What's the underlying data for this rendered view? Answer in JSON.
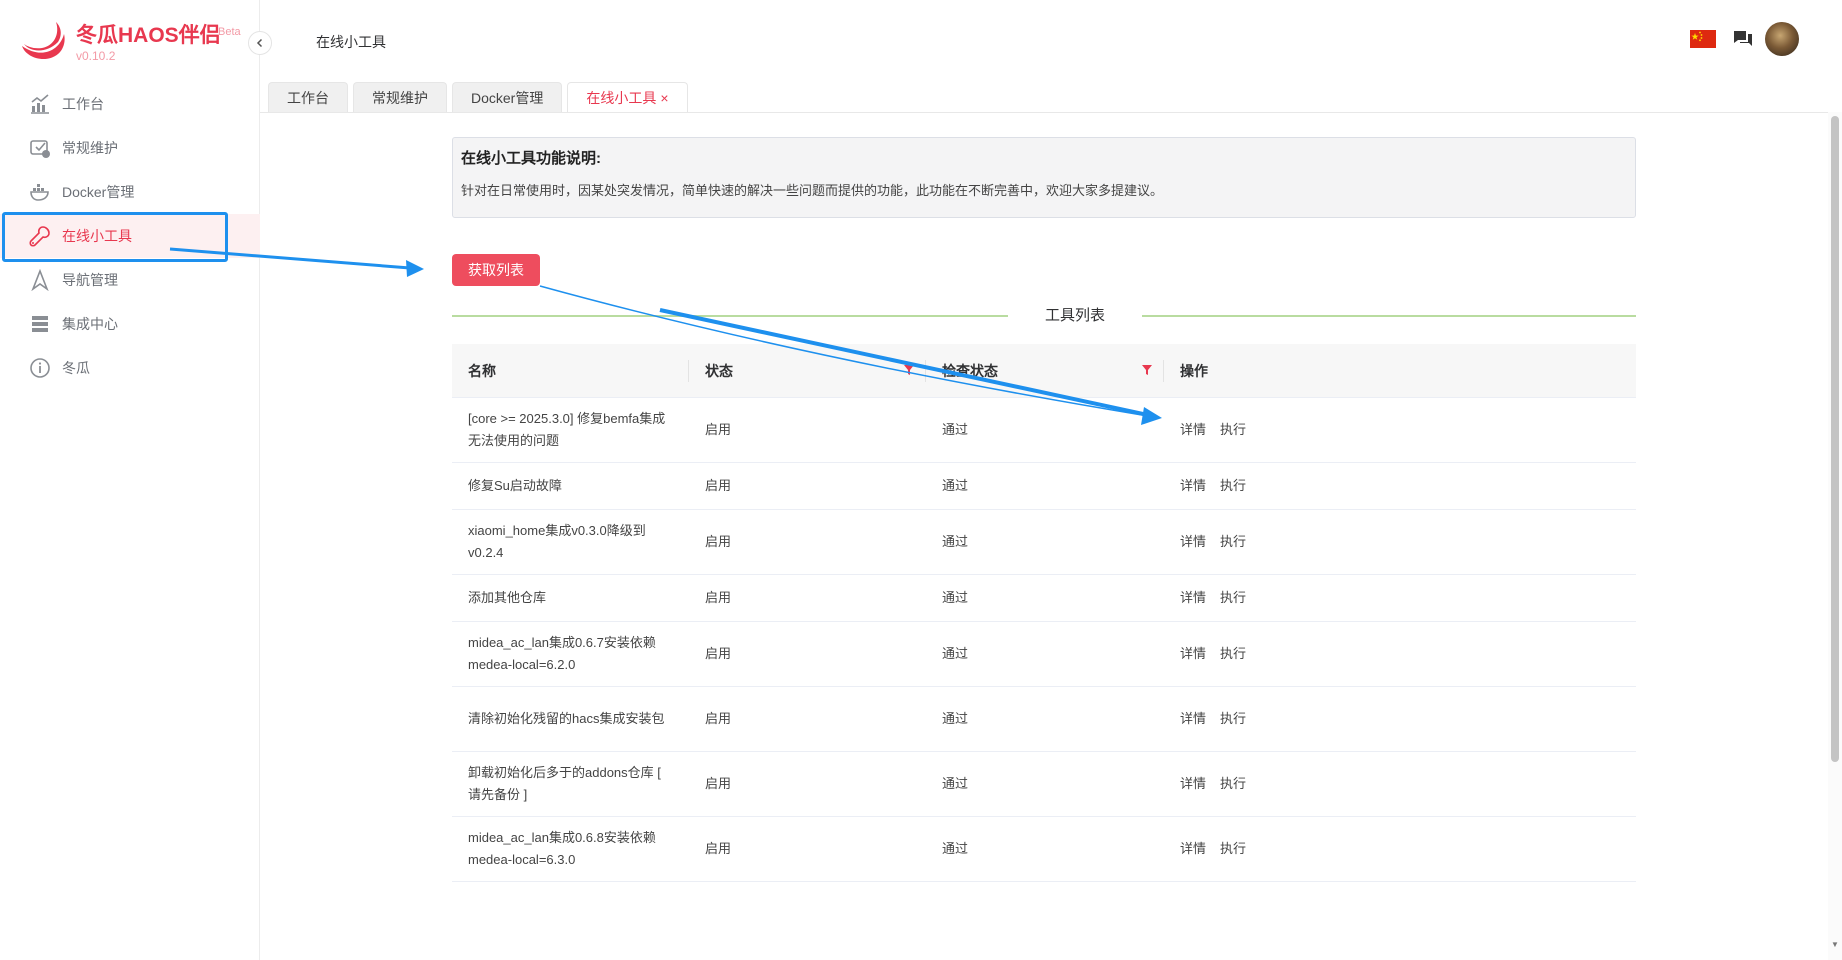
{
  "brand": {
    "name": "冬瓜HAOS伴侣",
    "beta": "Beta",
    "version": "v0.10.2",
    "color": "#e8384f"
  },
  "sidebar": {
    "items": [
      {
        "label": "工作台",
        "icon": "dashboard-chart-icon",
        "active": false
      },
      {
        "label": "常规维护",
        "icon": "maintenance-icon",
        "active": false
      },
      {
        "label": "Docker管理",
        "icon": "docker-icon",
        "active": false
      },
      {
        "label": "在线小工具",
        "icon": "wrench-icon",
        "active": true
      },
      {
        "label": "导航管理",
        "icon": "navigation-icon",
        "active": false
      },
      {
        "label": "集成中心",
        "icon": "server-icon",
        "active": false
      },
      {
        "label": "冬瓜",
        "icon": "info-icon",
        "active": false
      }
    ]
  },
  "header": {
    "title": "在线小工具",
    "icons": [
      "china-flag-icon",
      "chat-icon",
      "avatar"
    ]
  },
  "tabs": [
    {
      "label": "工作台",
      "active": false
    },
    {
      "label": "常规维护",
      "active": false
    },
    {
      "label": "Docker管理",
      "active": false
    },
    {
      "label": "在线小工具",
      "active": true,
      "close": "×"
    }
  ],
  "notice": {
    "title": "在线小工具功能说明:",
    "text": "针对在日常使用时，因某处突发情况，简单快速的解决一些问题而提供的功能，此功能在不断完善中，欢迎大家多提建议。"
  },
  "fetch_button": "获取列表",
  "divider_label": "工具列表",
  "table": {
    "headers": [
      "名称",
      "状态",
      "检查状态",
      "操作"
    ],
    "action_labels": [
      "详情",
      "执行"
    ],
    "rows": [
      {
        "name": "[core >= 2025.3.0] 修复bemfa集成无法使用的问题",
        "status": "启用",
        "check": "通过",
        "height": 65
      },
      {
        "name": "修复Su启动故障",
        "status": "启用",
        "check": "通过",
        "height": 47
      },
      {
        "name": "xiaomi_home集成v0.3.0降级到v0.2.4",
        "status": "启用",
        "check": "通过",
        "height": 65
      },
      {
        "name": "添加其他仓库",
        "status": "启用",
        "check": "通过",
        "height": 47
      },
      {
        "name": "midea_ac_lan集成0.6.7安装依赖medea-local=6.2.0",
        "status": "启用",
        "check": "通过",
        "height": 65
      },
      {
        "name": "清除初始化残留的hacs集成安装包",
        "status": "启用",
        "check": "通过",
        "height": 65
      },
      {
        "name": "卸载初始化后多于的addons仓库 [ 请先备份 ]",
        "status": "启用",
        "check": "通过",
        "height": 65
      },
      {
        "name": "midea_ac_lan集成0.6.8安装依赖medea-local=6.3.0",
        "status": "启用",
        "check": "通过",
        "height": 65
      }
    ]
  },
  "colors": {
    "accent": "#e8384f",
    "button": "#ee4d5e",
    "annotation": "#1e90ee",
    "divider": "#b9dca0"
  }
}
